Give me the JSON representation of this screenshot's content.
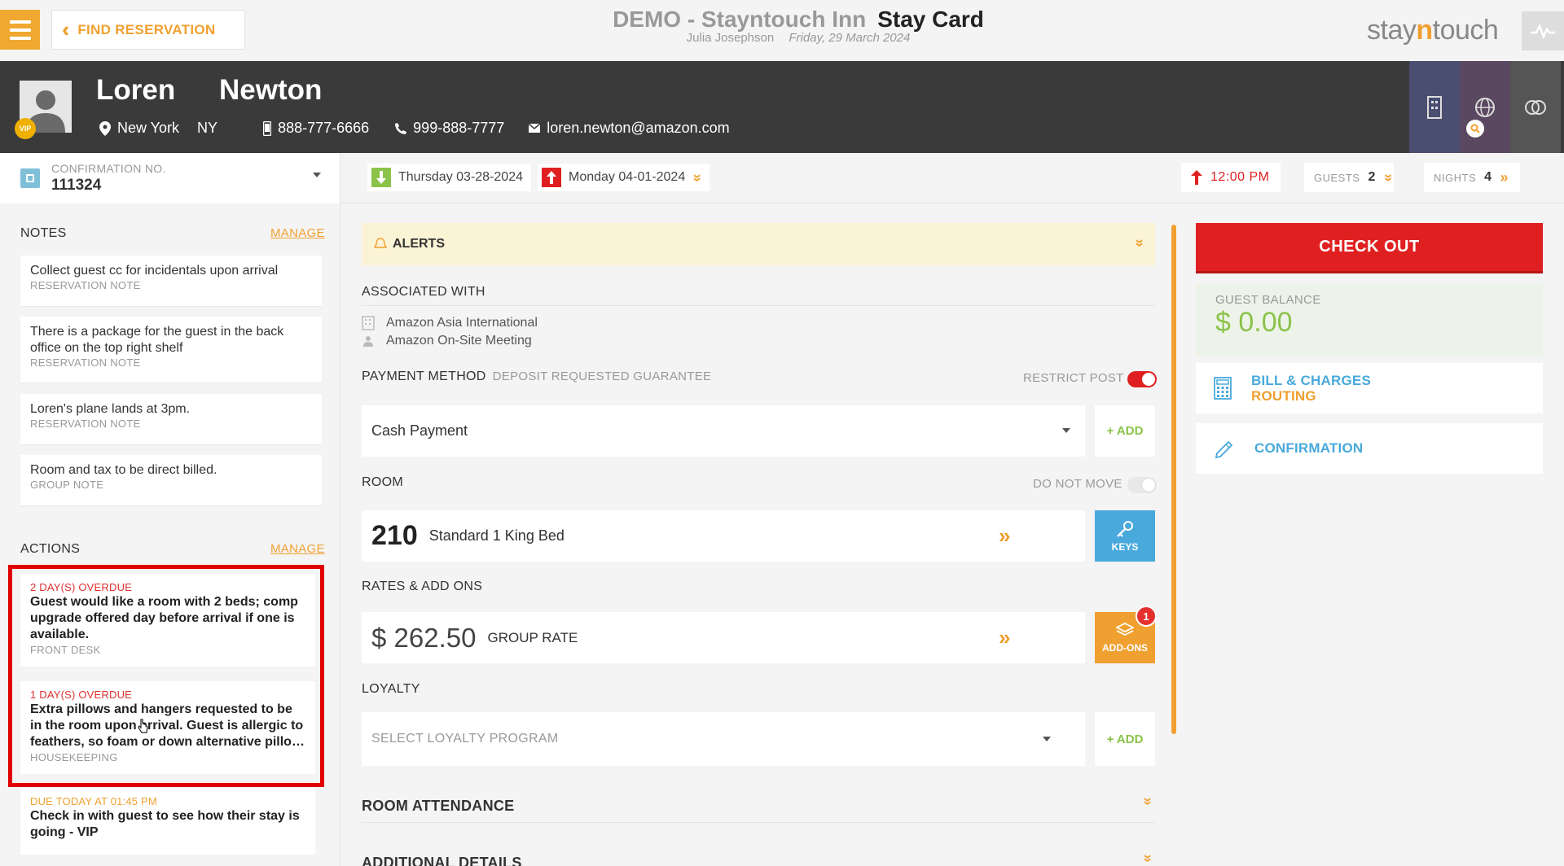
{
  "topbar": {
    "find_reservation": "FIND RESERVATION",
    "hotel_name": "DEMO - Stayntouch Inn",
    "page_title": "Stay Card",
    "user_name": "Julia Josephson",
    "business_date": "Friday, 29 March 2024",
    "logo_pre": "stay",
    "logo_n": "n",
    "logo_post": "touch"
  },
  "guest": {
    "first_name": "Loren",
    "last_name": "Newton",
    "city": "New York",
    "state": "NY",
    "mobile": "888-777-6666",
    "phone": "999-888-7777",
    "email": "loren.newton@amazon.com",
    "vip_badge": "VIP"
  },
  "reservation": {
    "confirmation_label": "CONFIRMATION NO.",
    "confirmation_no": "111324",
    "arrival": "Thursday 03-28-2024",
    "departure": "Monday 04-01-2024",
    "time": "12:00 PM",
    "guests_label": "GUESTS",
    "guests": "2",
    "nights_label": "NIGHTS",
    "nights": "4"
  },
  "notes": {
    "header": "NOTES",
    "manage": "MANAGE",
    "items": [
      {
        "text": "Collect guest cc for incidentals upon arrival",
        "kind": "RESERVATION NOTE"
      },
      {
        "text": "There is a package for the guest in the back office on the top right shelf",
        "kind": "RESERVATION NOTE"
      },
      {
        "text": "Loren's plane lands at 3pm.",
        "kind": "RESERVATION NOTE"
      },
      {
        "text": "Room and tax to be direct billed.",
        "kind": "GROUP NOTE"
      }
    ]
  },
  "actions": {
    "header": "ACTIONS",
    "manage": "MANAGE",
    "items": [
      {
        "due": "2 DAY(S) OVERDUE",
        "text": "Guest would like a room with 2 beds; comp upgrade offered day before arrival if one is available.",
        "dept": "FRONT DESK"
      },
      {
        "due": "1 DAY(S) OVERDUE",
        "text": "Extra pillows and hangers requested to be in the room upon arrival. Guest is allergic to feathers, so foam or down alternative pillo…",
        "dept": "HOUSEKEEPING"
      },
      {
        "due": "DUE TODAY AT 01:45 PM",
        "text": "Check in with guest to see how their stay is going - VIP",
        "dept": ""
      }
    ]
  },
  "main": {
    "alerts": "ALERTS",
    "associated_with": "ASSOCIATED WITH",
    "company": "Amazon Asia International",
    "group": "Amazon On-Site Meeting",
    "payment_method": "PAYMENT METHOD",
    "payment_sub": "DEPOSIT REQUESTED GUARANTEE",
    "restrict_post": "RESTRICT POST",
    "payment_value": "Cash Payment",
    "add": "+ ADD",
    "room_label": "ROOM",
    "do_not_move": "DO NOT MOVE",
    "room_number": "210",
    "room_type": "Standard 1 King Bed",
    "keys": "KEYS",
    "rates_label": "RATES & ADD ONS",
    "rate_amount": "$ 262.50",
    "rate_name": "GROUP RATE",
    "addons": "ADD-ONS",
    "addons_count": "1",
    "loyalty_label": "LOYALTY",
    "loyalty_placeholder": "SELECT LOYALTY PROGRAM",
    "room_attendance": "ROOM ATTENDANCE",
    "additional_details": "ADDITIONAL DETAILS"
  },
  "side": {
    "check_out": "CHECK OUT",
    "balance_label": "GUEST BALANCE",
    "balance_value": "$ 0.00",
    "bill_line1": "BILL & CHARGES",
    "bill_line2": "ROUTING",
    "confirmation": "CONFIRMATION"
  },
  "colors": {
    "accent": "#f0a030",
    "danger": "#e02020",
    "info": "#49a9dc",
    "success": "#8bc34a",
    "header_bg": "#3a3a3a"
  }
}
